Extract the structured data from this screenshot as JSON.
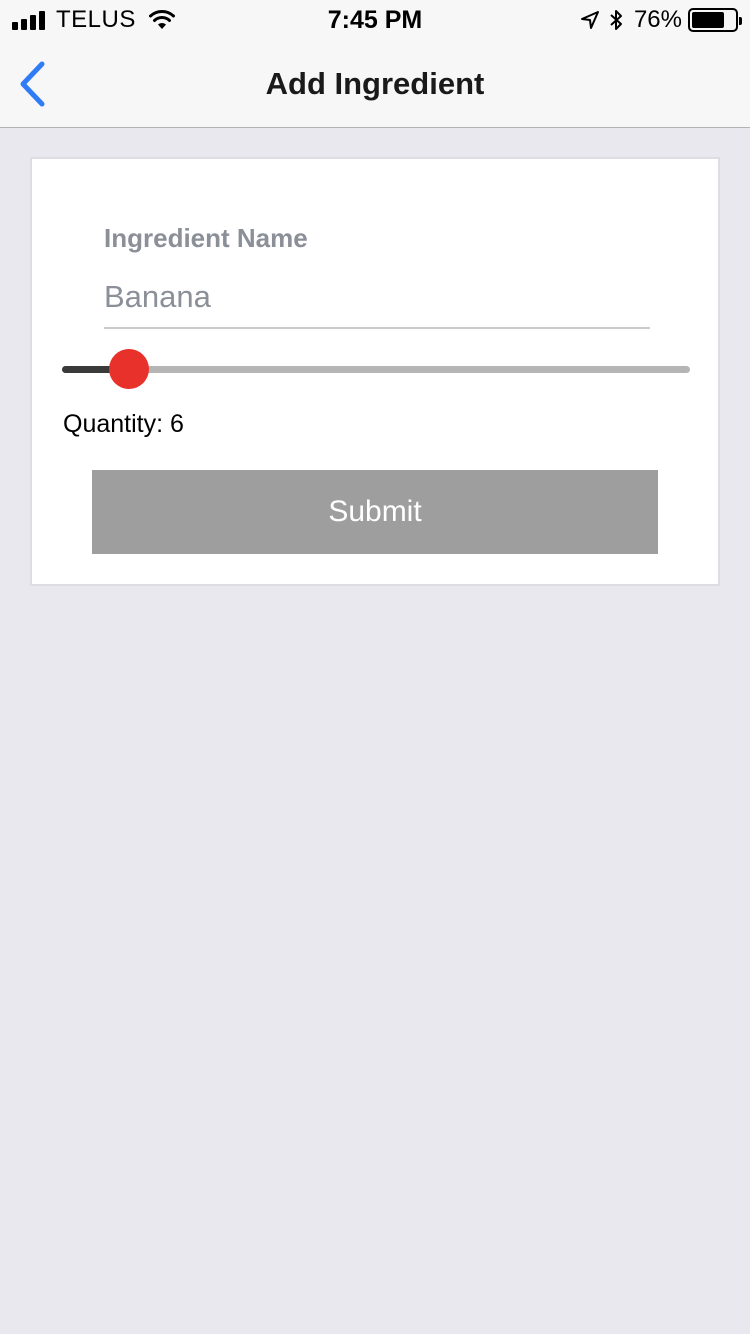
{
  "status_bar": {
    "carrier": "TELUS",
    "time": "7:45 PM",
    "battery_percent_text": "76%",
    "battery_level": 0.76,
    "icons": [
      "signal-icon",
      "wifi-icon",
      "location-arrow-icon",
      "bluetooth-icon",
      "battery-icon"
    ]
  },
  "nav": {
    "title": "Add Ingredient",
    "back_icon": "chevron-left-icon",
    "accent_color": "#2f7cf6"
  },
  "form": {
    "name_label": "Ingredient Name",
    "name_value": "Banana",
    "slider": {
      "value_fraction": 0.08,
      "thumb_color": "#e8312a"
    },
    "quantity_label": "Quantity: 6",
    "submit_label": "Submit",
    "submit_color": "#9e9e9e"
  }
}
